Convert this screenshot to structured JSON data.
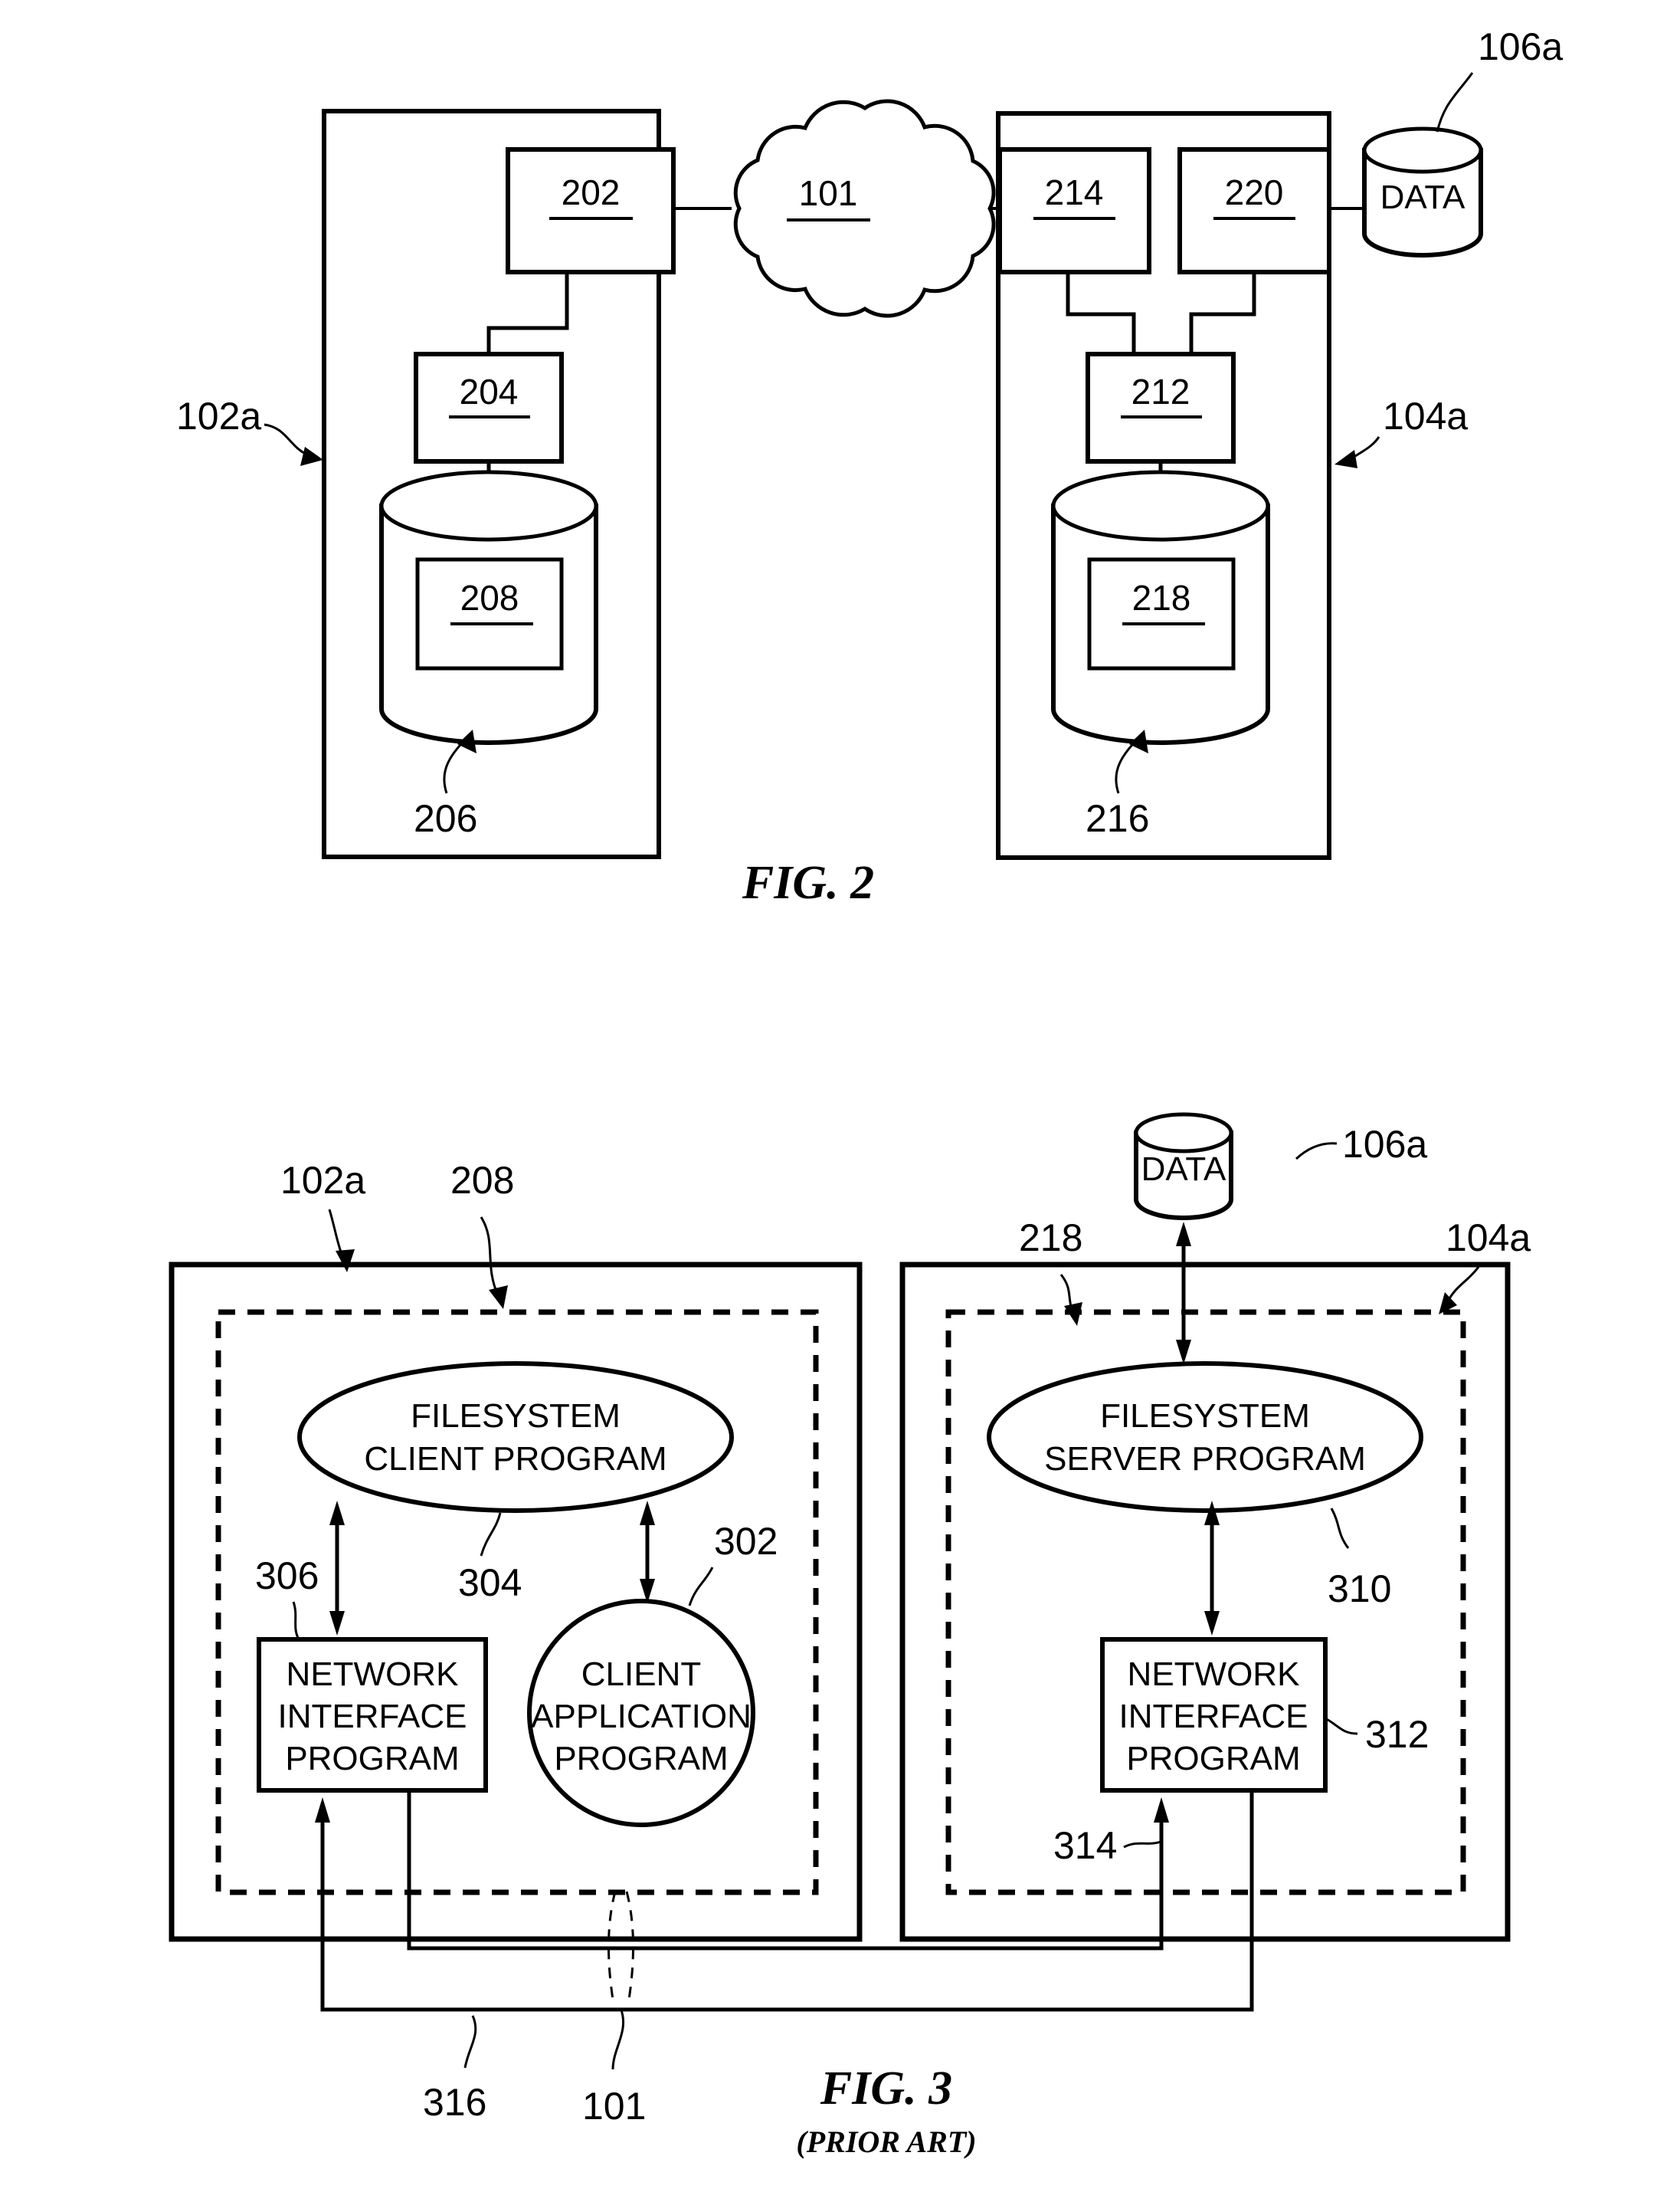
{
  "document": {
    "type": "patent-drawing-sheet",
    "figures": [
      {
        "caption": "FIG. 2",
        "subcaption": "",
        "id": "figure-2",
        "blocks": [
          {
            "ref": "202",
            "label": "202"
          },
          {
            "ref": "204",
            "label": "204"
          },
          {
            "ref": "208",
            "label": "208"
          },
          {
            "ref": "101",
            "label": "101"
          },
          {
            "ref": "214",
            "label": "214"
          },
          {
            "ref": "220",
            "label": "220"
          },
          {
            "ref": "212",
            "label": "212"
          },
          {
            "ref": "218",
            "label": "218"
          }
        ],
        "cylinder_label": "DATA",
        "callouts": [
          {
            "ref": "102a",
            "label": "102a"
          },
          {
            "ref": "104a",
            "label": "104a"
          },
          {
            "ref": "106a",
            "label": "106a"
          },
          {
            "ref": "206",
            "label": "206"
          },
          {
            "ref": "216",
            "label": "216"
          }
        ]
      },
      {
        "caption": "FIG. 3",
        "subcaption": "(PRIOR ART)",
        "id": "figure-3",
        "left_panel": {
          "callout_outer": "102a",
          "callout_inner": "208",
          "ellipse_line1": "FILESYSTEM",
          "ellipse_line2": "CLIENT PROGRAM",
          "ellipse_ref": "304",
          "box_line1": "NETWORK",
          "box_line2": "INTERFACE",
          "box_line3": "PROGRAM",
          "box_ref": "306",
          "circle_line1": "CLIENT",
          "circle_line2": "APPLICATION",
          "circle_line3": "PROGRAM",
          "circle_ref": "302"
        },
        "right_panel": {
          "callout_outer": "104a",
          "callout_inner": "218",
          "ellipse_line1": "FILESYSTEM",
          "ellipse_line2": "SERVER PROGRAM",
          "ellipse_ref": "310",
          "box_line1": "NETWORK",
          "box_line2": "INTERFACE",
          "box_line3": "PROGRAM",
          "box_ref": "312",
          "arrow_ref": "314",
          "cylinder_label": "DATA",
          "cylinder_ref": "106a"
        },
        "bottom": {
          "link_ref": "316",
          "network_ref": "101"
        }
      }
    ]
  }
}
